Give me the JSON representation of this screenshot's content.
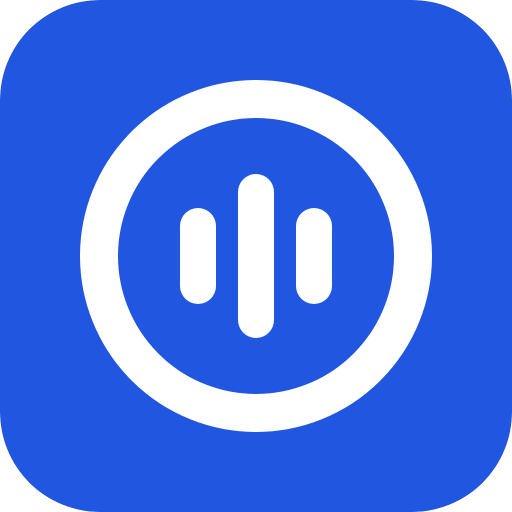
{
  "icon": {
    "name": "audio-waveform-icon",
    "background_color": "#2157E0",
    "foreground_color": "#FFFFFF"
  }
}
